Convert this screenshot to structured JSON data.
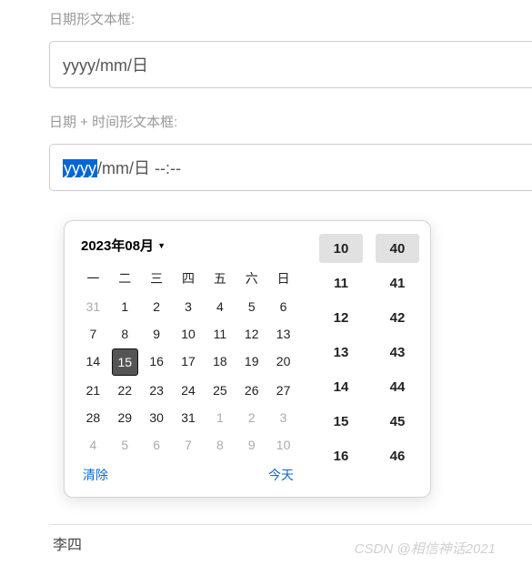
{
  "field1": {
    "label": "日期形文本框:",
    "value": "yyyy/mm/日"
  },
  "field2": {
    "label": "日期 + 时间形文本框:",
    "segments": {
      "selected": "yyyy",
      "rest": "/mm/日 --:--"
    }
  },
  "picker": {
    "monthLabel": "2023年08月",
    "weekdays": [
      "一",
      "二",
      "三",
      "四",
      "五",
      "六",
      "日"
    ],
    "days": [
      {
        "n": 31,
        "other": true
      },
      {
        "n": 1
      },
      {
        "n": 2
      },
      {
        "n": 3
      },
      {
        "n": 4
      },
      {
        "n": 5
      },
      {
        "n": 6
      },
      {
        "n": 7
      },
      {
        "n": 8
      },
      {
        "n": 9
      },
      {
        "n": 10
      },
      {
        "n": 11
      },
      {
        "n": 12
      },
      {
        "n": 13
      },
      {
        "n": 14
      },
      {
        "n": 15,
        "today": true
      },
      {
        "n": 16
      },
      {
        "n": 17
      },
      {
        "n": 18
      },
      {
        "n": 19
      },
      {
        "n": 20
      },
      {
        "n": 21
      },
      {
        "n": 22
      },
      {
        "n": 23
      },
      {
        "n": 24
      },
      {
        "n": 25
      },
      {
        "n": 26
      },
      {
        "n": 27
      },
      {
        "n": 28
      },
      {
        "n": 29
      },
      {
        "n": 30
      },
      {
        "n": 31
      },
      {
        "n": 1,
        "other": true
      },
      {
        "n": 2,
        "other": true
      },
      {
        "n": 3,
        "other": true
      },
      {
        "n": 4,
        "other": true
      },
      {
        "n": 5,
        "other": true
      },
      {
        "n": 6,
        "other": true
      },
      {
        "n": 7,
        "other": true
      },
      {
        "n": 8,
        "other": true
      },
      {
        "n": 9,
        "other": true
      },
      {
        "n": 10,
        "other": true
      }
    ],
    "clearLabel": "清除",
    "todayLabel": "今天",
    "hours": [
      {
        "v": 10,
        "selected": true
      },
      {
        "v": 11
      },
      {
        "v": 12
      },
      {
        "v": 13
      },
      {
        "v": 14
      },
      {
        "v": 15
      },
      {
        "v": 16
      }
    ],
    "minutes": [
      {
        "v": 40,
        "selected": true
      },
      {
        "v": 41
      },
      {
        "v": 42
      },
      {
        "v": 43
      },
      {
        "v": 44
      },
      {
        "v": 45
      },
      {
        "v": 46
      }
    ]
  },
  "bgRowText": "李四",
  "watermark": "CSDN @相信神话2021"
}
